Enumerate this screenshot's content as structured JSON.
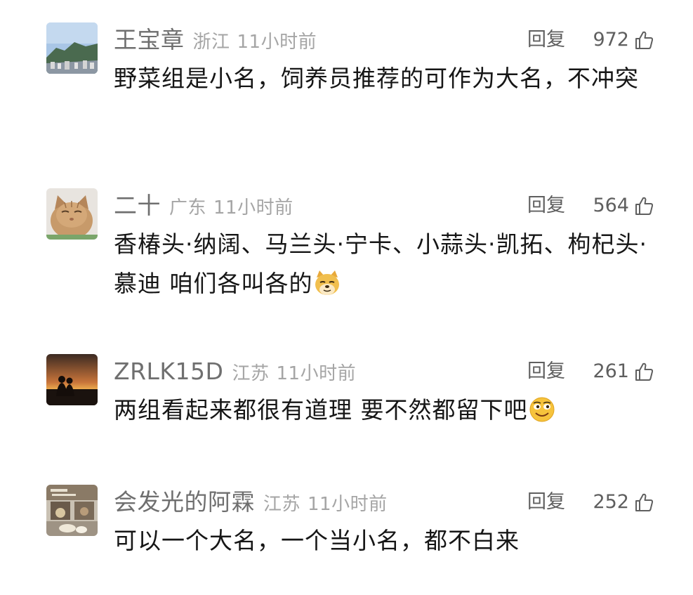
{
  "comments": [
    {
      "user": "王宝章",
      "location": "浙江",
      "time": "11小时前",
      "reply": "回复",
      "likes": "972",
      "text": "野菜组是小名，饲养员推荐的可作为大名，不冲突",
      "avatar": "mountain-city-avatar"
    },
    {
      "user": "二十",
      "location": "广东",
      "time": "11小时前",
      "reply": "回复",
      "likes": "564",
      "text": "香椿头·纳阔、马兰头·宁卡、小蒜头·凯拓、枸杞头·慕迪 咱们各叫各的",
      "emoji": "doge-emoji",
      "avatar": "cat-avatar"
    },
    {
      "user": "ZRLK15D",
      "location": "江苏",
      "time": "11小时前",
      "reply": "回复",
      "likes": "261",
      "text": "两组看起来都很有道理 要不然都留下吧",
      "emoji": "grin-emoji",
      "avatar": "sunset-couple-avatar"
    },
    {
      "user": "会发光的阿霖",
      "location": "江苏",
      "time": "11小时前",
      "reply": "回复",
      "likes": "252",
      "text": "可以一个大名，一个当小名，都不白来",
      "avatar": "shopfront-avatar"
    }
  ],
  "icons": {
    "like": "thumbs-up-icon"
  },
  "colors": {
    "name": "#6f6f6f",
    "meta": "#a5a5a5",
    "text": "#161616",
    "action": "#5f5f5f"
  }
}
